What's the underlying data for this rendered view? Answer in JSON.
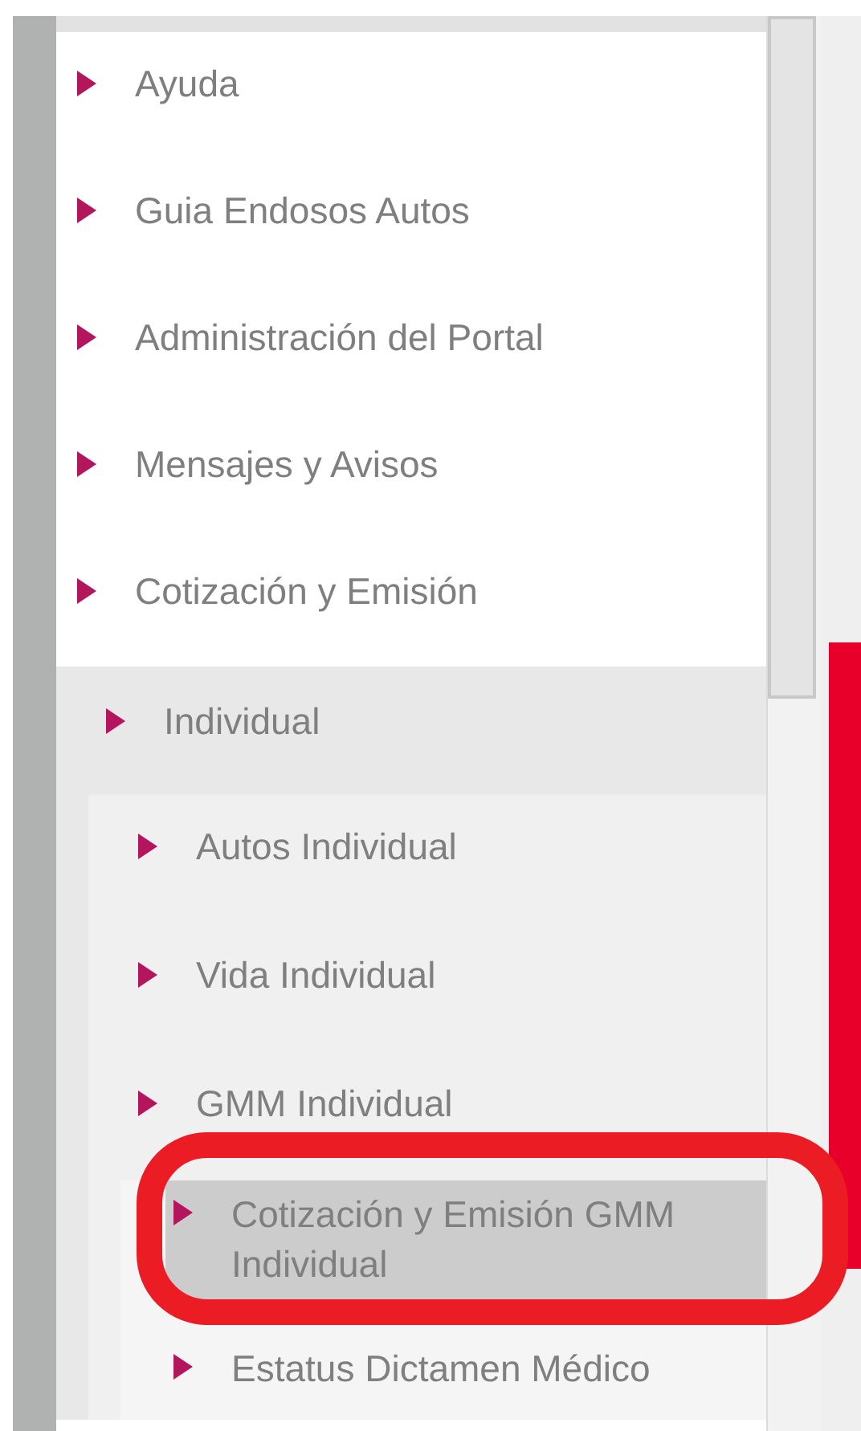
{
  "menu": {
    "items": [
      {
        "label": "Ayuda",
        "selected": false
      },
      {
        "label": "Guia Endosos Autos",
        "selected": false
      },
      {
        "label": "Administración del Portal",
        "selected": false
      },
      {
        "label": "Mensajes y Avisos",
        "selected": false
      },
      {
        "label": "Cotización y Emisión",
        "selected": false,
        "children": [
          {
            "label": "Individual",
            "selected": false,
            "children": [
              {
                "label": "Autos Individual",
                "selected": false
              },
              {
                "label": "Vida Individual",
                "selected": false
              },
              {
                "label": "GMM Individual",
                "selected": false,
                "children": [
                  {
                    "label": "Cotización y Emisión GMM Individual",
                    "selected": true
                  },
                  {
                    "label": "Estatus Dictamen Médico",
                    "selected": false
                  }
                ]
              }
            ]
          }
        ]
      }
    ]
  }
}
